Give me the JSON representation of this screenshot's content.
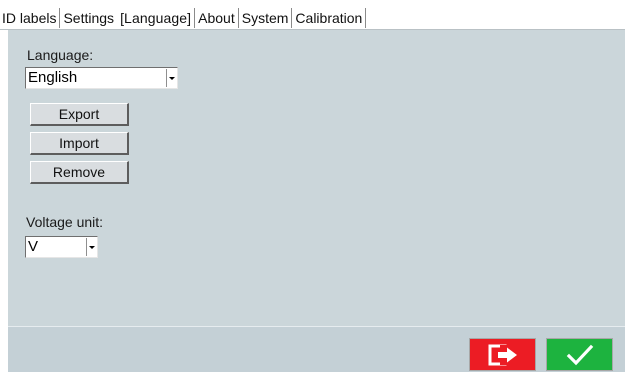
{
  "tabs": [
    {
      "label": "ID labels"
    },
    {
      "label": "Settings"
    },
    {
      "label": "[Language]"
    },
    {
      "label": "About"
    },
    {
      "label": "System"
    },
    {
      "label": "Calibration"
    }
  ],
  "language_section": {
    "label": "Language:",
    "selected": "English"
  },
  "buttons": {
    "export": "Export",
    "import": "Import",
    "remove": "Remove"
  },
  "voltage_section": {
    "label": "Voltage unit:",
    "selected": "V"
  },
  "footer": {
    "exit_icon": "exit-icon",
    "ok_icon": "checkmark-icon",
    "exit_color": "#ec1c24",
    "ok_color": "#1db33f"
  },
  "colors": {
    "panel_background": "#cbd6da"
  }
}
